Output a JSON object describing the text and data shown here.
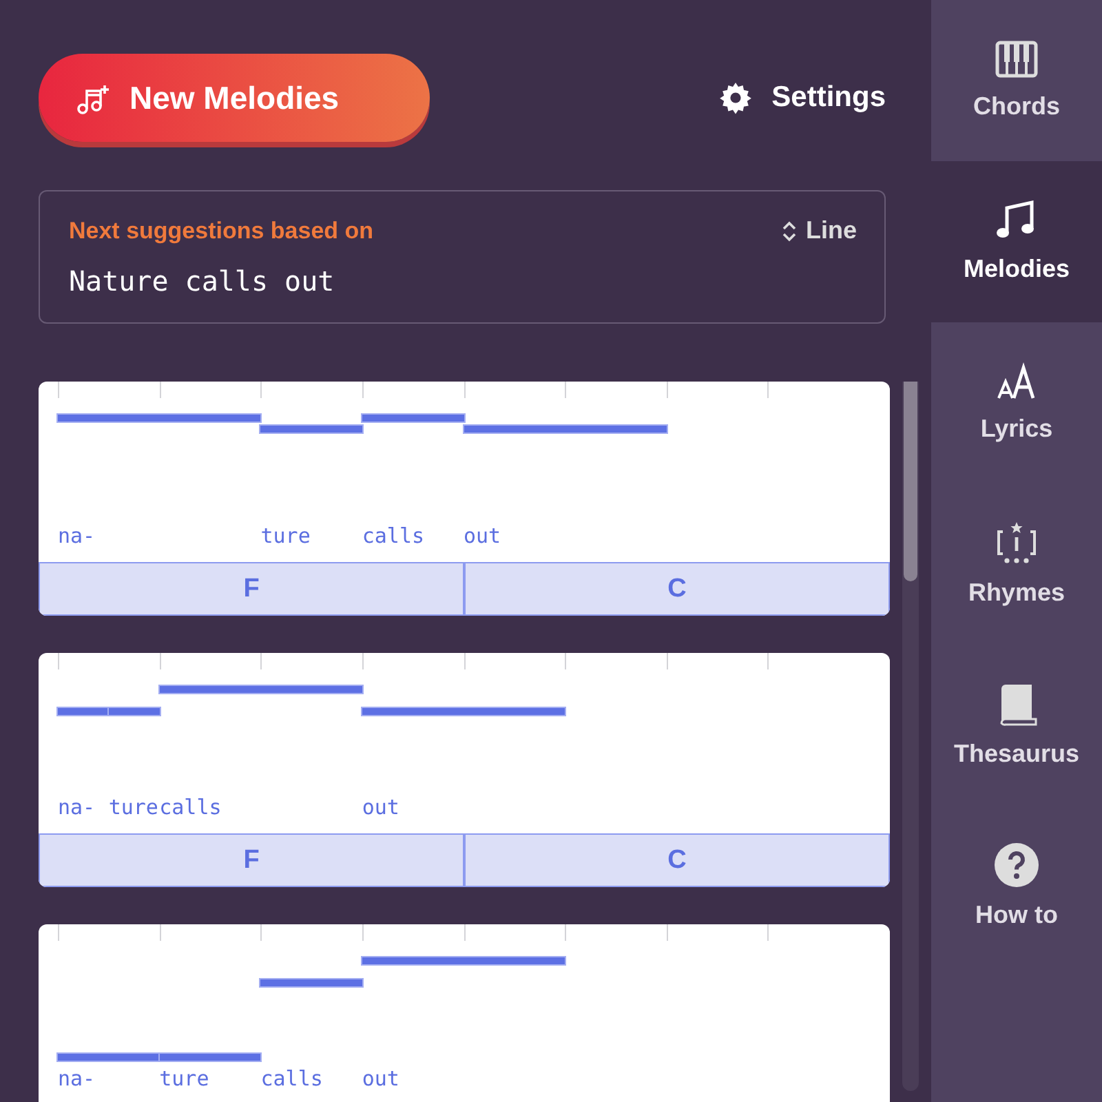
{
  "header": {
    "new_button": "New Melodies",
    "settings": "Settings"
  },
  "suggestion": {
    "label": "Next suggestions based on",
    "line": "Nature calls out",
    "mode": "Line"
  },
  "melodies": [
    {
      "lyrics": [
        "na-",
        "ture",
        "calls",
        "out"
      ],
      "chords": [
        "F",
        "C"
      ]
    },
    {
      "lyrics": [
        "na-",
        "ture",
        "calls",
        "out"
      ],
      "chords": [
        "F",
        "C"
      ]
    },
    {
      "lyrics": [
        "na-",
        "ture",
        "calls",
        "out"
      ]
    }
  ],
  "nav": [
    {
      "kind": "piano",
      "label": "Chords",
      "selected": false
    },
    {
      "kind": "note",
      "label": "Melodies",
      "selected": true
    },
    {
      "kind": "letters",
      "label": "Lyrics",
      "selected": false
    },
    {
      "kind": "rhyme",
      "label": "Rhymes",
      "selected": false
    },
    {
      "kind": "book",
      "label": "Thesaurus",
      "selected": false
    },
    {
      "kind": "help",
      "label": "How to",
      "selected": false
    }
  ]
}
